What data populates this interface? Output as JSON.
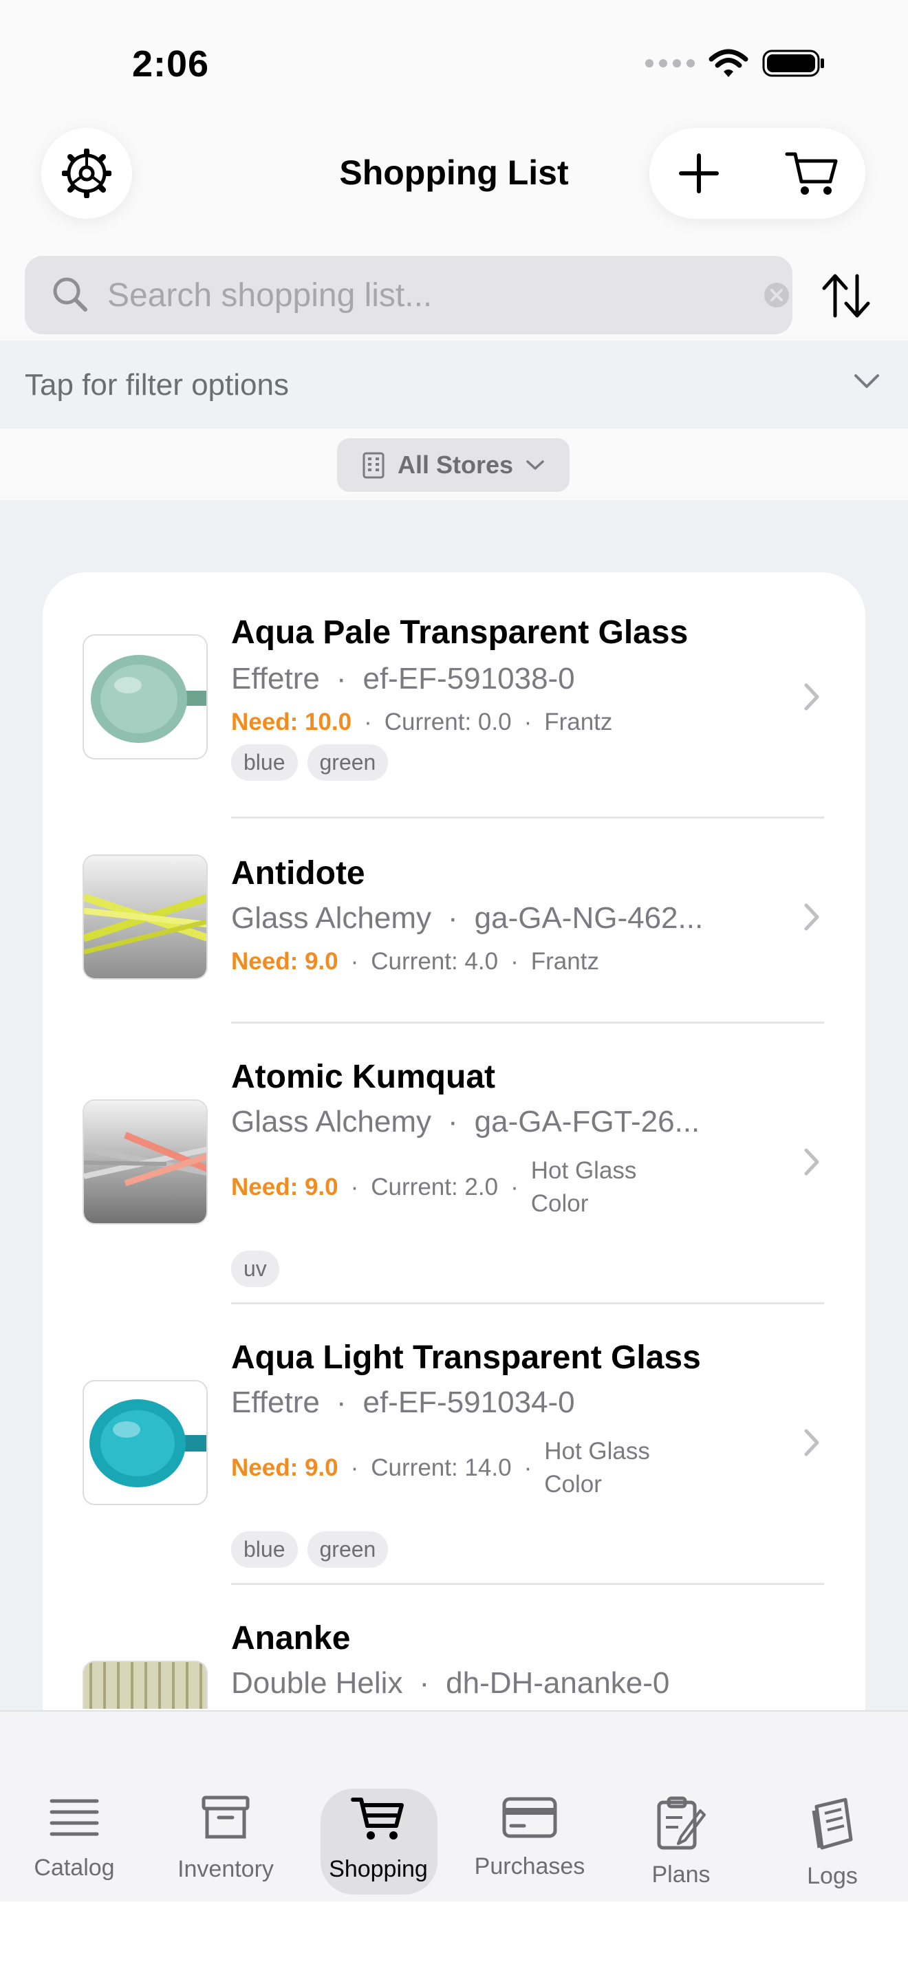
{
  "status": {
    "time": "2:06"
  },
  "header": {
    "title": "Shopping List"
  },
  "search": {
    "placeholder": "Search shopping list..."
  },
  "filter": {
    "label": "Tap for filter options"
  },
  "store": {
    "label": "All Stores"
  },
  "items": [
    {
      "title": "Aqua Pale Transparent Glass",
      "brand": "Effetre",
      "code": "ef-EF-591038-0",
      "need": "Need: 10.0",
      "current": "Current: 0.0",
      "store_l1": "Frantz",
      "store_l2": "",
      "tags": [
        "blue",
        "green"
      ],
      "swatch": "#8fbfae"
    },
    {
      "title": "Antidote",
      "brand": "Glass Alchemy",
      "code": "ga-GA-NG-462...",
      "need": "Need: 9.0",
      "current": "Current: 4.0",
      "store_l1": "Frantz",
      "store_l2": "",
      "tags": [],
      "swatch": "#e3ea55"
    },
    {
      "title": "Atomic Kumquat",
      "brand": "Glass Alchemy",
      "code": "ga-GA-FGT-26...",
      "need": "Need: 9.0",
      "current": "Current: 2.0",
      "store_l1": "Hot Glass",
      "store_l2": "Color",
      "tags": [
        "uv"
      ],
      "swatch": "#f08b7a"
    },
    {
      "title": "Aqua Light Transparent Glass",
      "brand": "Effetre",
      "code": "ef-EF-591034-0",
      "need": "Need: 9.0",
      "current": "Current: 14.0",
      "store_l1": "Hot Glass",
      "store_l2": "Color",
      "tags": [
        "blue",
        "green"
      ],
      "swatch": "#1aa7b5"
    },
    {
      "title": "Ananke",
      "brand": "Double Helix",
      "code": "dh-DH-ananke-0",
      "need": "",
      "current": "",
      "store_l1": "",
      "store_l2": "",
      "tags": [],
      "swatch": "#c9c79a"
    }
  ],
  "tabs": [
    {
      "label": "Catalog",
      "icon": "list-icon"
    },
    {
      "label": "Inventory",
      "icon": "archive-box-icon"
    },
    {
      "label": "Shopping",
      "icon": "cart-icon",
      "active": true
    },
    {
      "label": "Purchases",
      "icon": "credit-card-icon"
    },
    {
      "label": "Plans",
      "icon": "clipboard-pencil-icon"
    },
    {
      "label": "Logs",
      "icon": "notebook-icon"
    }
  ],
  "colors": {
    "need": "#f28c1f",
    "accent": "#000000"
  }
}
